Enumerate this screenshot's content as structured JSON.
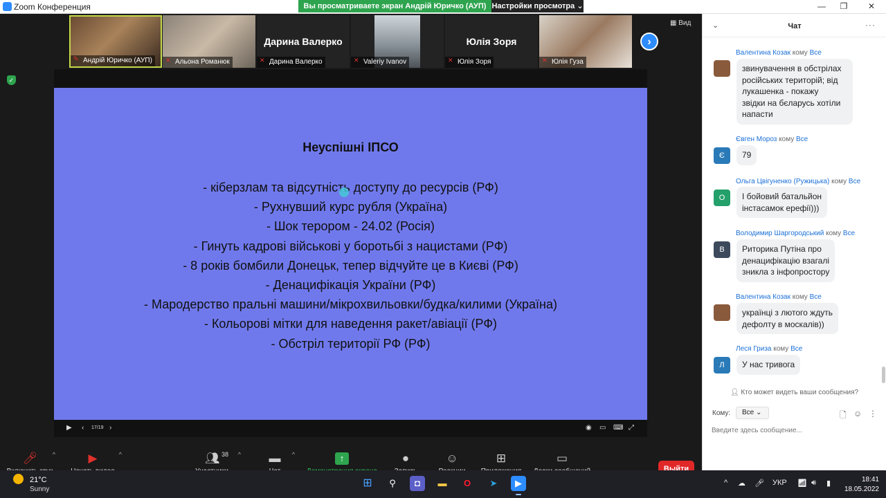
{
  "window": {
    "title": "Zoom Конференция"
  },
  "share_banner": {
    "text": "Вы просматриваете экран Андрій Юричко (АУП)",
    "view_options": "Настройки просмотра"
  },
  "gallery": {
    "view_label": "Вид",
    "participants": [
      {
        "name": "Андрій Юричко (АУП)",
        "video": true,
        "active": true
      },
      {
        "name": "Альона Романюк",
        "video": true,
        "active": false
      },
      {
        "name": "Дарина Валерко",
        "big_label": "Дарина Валерко",
        "video": false,
        "active": false
      },
      {
        "name": "Valeriy Ivanov",
        "video": true,
        "active": false
      },
      {
        "name": "Юлія Зоря",
        "big_label": "Юлія Зоря",
        "video": false,
        "active": false
      },
      {
        "name": "Юлія Гуза",
        "video": true,
        "active": false
      }
    ]
  },
  "slide": {
    "title": "Неуспішні ІПСО",
    "lines": [
      "- кіберзлам та відсутність доступу до ресурсів (РФ)",
      "- Рухнувший курс рубля (Україна)",
      "- Шок терором -  24.02 (Росія)",
      "- Гинуть кадрові військові у боротьбі з нацистами (РФ)",
      "- 8 років бомбили Донецьк, тепер відчуйте це в Києві (РФ)",
      "- Денацифікація України (РФ)",
      "- Мародерство пральні машини/мікрохвильовки/будка/килими (Україна)",
      "- Кольорові мітки для наведення ракет/авіації (РФ)",
      "- Обстріл території РФ (РФ)"
    ],
    "page_indicator": "17/19"
  },
  "toolbar": {
    "audio": "Включить звук",
    "video": "Начать видео",
    "participants": "Участники",
    "participants_count": "38",
    "chat": "Чат",
    "share": "Демонстрация экрана",
    "record": "Запись",
    "reactions": "Реакции",
    "apps": "Приложения",
    "whiteboards": "Доски сообщений",
    "leave": "Выйти"
  },
  "chat": {
    "title": "Чат",
    "to_word": "кому",
    "all_word": "Все",
    "messages": [
      {
        "from": "Валентина Козак",
        "avatar": "",
        "avatar_color": "#8a5a3c",
        "text_lines": [
          "звинувачення в обстрілах",
          "російських територій; від",
          "лукашенка - покажу",
          "звідки на бєларусь хотіли",
          "напасти"
        ]
      },
      {
        "from": "Євген Мороз",
        "avatar": "Є",
        "avatar_color": "#2a7ab8",
        "text_lines": [
          "79"
        ]
      },
      {
        "from": "Ольга Цвігуненко (Ружицька)",
        "avatar": "О",
        "avatar_color": "#24a06b",
        "text_lines": [
          "І бойовий батальйон",
          "інстасамок ерефії)))"
        ]
      },
      {
        "from": "Володимир Шаргородський",
        "avatar": "В",
        "avatar_color": "#3d4a5c",
        "text_lines": [
          "Риторика Путіна про",
          "денацифікацію взагалі",
          "зникла з інфопростору"
        ]
      },
      {
        "from": "Валентина Козак",
        "avatar": "",
        "avatar_color": "#8a5a3c",
        "text_lines": [
          "українці з лютого ждуть",
          "дефолту в москалів))"
        ]
      },
      {
        "from": "Леся Гриза",
        "avatar": "Л",
        "avatar_color": "#2a7ab8",
        "text_lines": [
          "У нас  тривога"
        ]
      }
    ],
    "who_can_see": "Кто может видеть ваши сообщения?",
    "to_label": "Кому:",
    "to_value": "Все",
    "input_placeholder": "Введите здесь сообщение..."
  },
  "taskbar": {
    "weather_temp": "21°C",
    "weather_desc": "Sunny",
    "language": "УКР",
    "time": "18:41",
    "date": "18.05.2022"
  }
}
